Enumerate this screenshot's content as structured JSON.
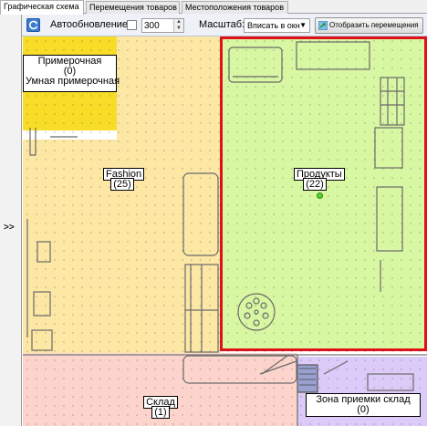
{
  "tabs": [
    {
      "label": "Графическая схема",
      "active": true
    },
    {
      "label": "Перемещения товаров",
      "active": false
    },
    {
      "label": "Местоположения товаров",
      "active": false
    }
  ],
  "left_panel": {
    "expand_label": ">>"
  },
  "toolbar": {
    "refresh_icon": "refresh-icon",
    "autoupdate_label": "Автообновление",
    "autoupdate_checked": false,
    "interval_value": "300",
    "scale_label": "Масштаб:",
    "scale_value": "Вписать в окн",
    "show_moves_label": "Отобразить перемещения",
    "show_moves_icon": "map-arrows-icon"
  },
  "zones": {
    "fitting": {
      "name": "Примерочная",
      "count": "(0)",
      "subtitle": "Умная примерочная",
      "color": "#f7dd28"
    },
    "fashion": {
      "name": "Fashion",
      "count": "(25)",
      "color": "#fde7a5"
    },
    "products": {
      "name": "Продукты",
      "count": "(22)",
      "color": "#d8f7a2",
      "selected_border": "#e0101a"
    },
    "warehouse": {
      "name": "Склад",
      "count": "(1)",
      "color": "#fcd4cc"
    },
    "receiving": {
      "name": "Зона приемки склад",
      "count": "(0)",
      "color": "#dccbf8"
    }
  },
  "marker_color": "#58d22a"
}
